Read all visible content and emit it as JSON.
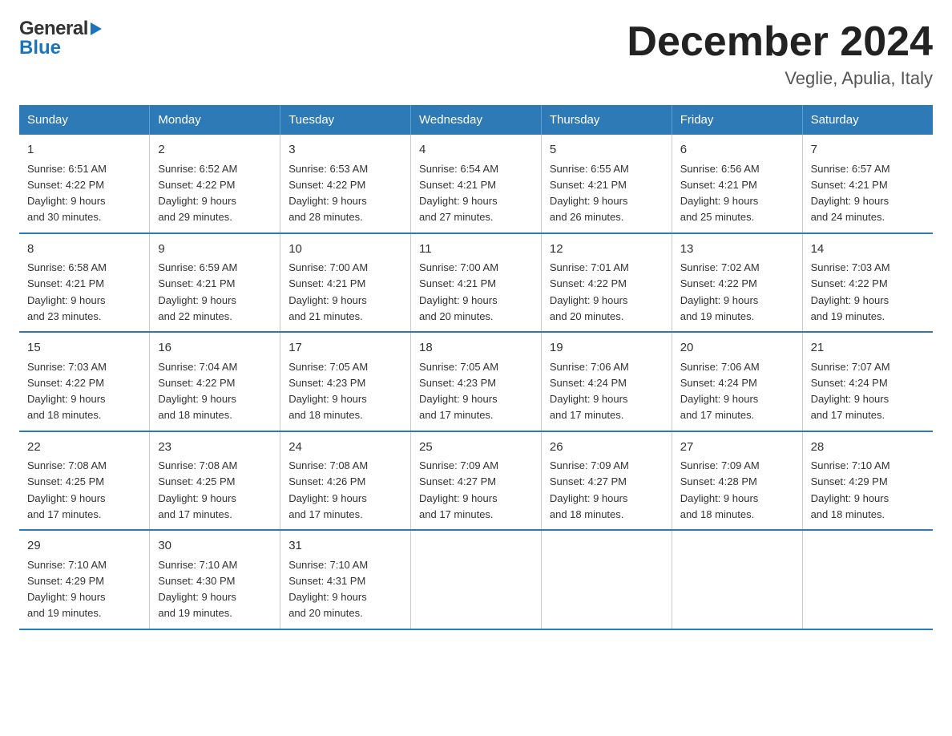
{
  "logo": {
    "line1": "General",
    "line2": "Blue"
  },
  "title": "December 2024",
  "subtitle": "Veglie, Apulia, Italy",
  "days_of_week": [
    "Sunday",
    "Monday",
    "Tuesday",
    "Wednesday",
    "Thursday",
    "Friday",
    "Saturday"
  ],
  "weeks": [
    [
      {
        "day": "1",
        "sunrise": "6:51 AM",
        "sunset": "4:22 PM",
        "daylight": "9 hours and 30 minutes."
      },
      {
        "day": "2",
        "sunrise": "6:52 AM",
        "sunset": "4:22 PM",
        "daylight": "9 hours and 29 minutes."
      },
      {
        "day": "3",
        "sunrise": "6:53 AM",
        "sunset": "4:22 PM",
        "daylight": "9 hours and 28 minutes."
      },
      {
        "day": "4",
        "sunrise": "6:54 AM",
        "sunset": "4:21 PM",
        "daylight": "9 hours and 27 minutes."
      },
      {
        "day": "5",
        "sunrise": "6:55 AM",
        "sunset": "4:21 PM",
        "daylight": "9 hours and 26 minutes."
      },
      {
        "day": "6",
        "sunrise": "6:56 AM",
        "sunset": "4:21 PM",
        "daylight": "9 hours and 25 minutes."
      },
      {
        "day": "7",
        "sunrise": "6:57 AM",
        "sunset": "4:21 PM",
        "daylight": "9 hours and 24 minutes."
      }
    ],
    [
      {
        "day": "8",
        "sunrise": "6:58 AM",
        "sunset": "4:21 PM",
        "daylight": "9 hours and 23 minutes."
      },
      {
        "day": "9",
        "sunrise": "6:59 AM",
        "sunset": "4:21 PM",
        "daylight": "9 hours and 22 minutes."
      },
      {
        "day": "10",
        "sunrise": "7:00 AM",
        "sunset": "4:21 PM",
        "daylight": "9 hours and 21 minutes."
      },
      {
        "day": "11",
        "sunrise": "7:00 AM",
        "sunset": "4:21 PM",
        "daylight": "9 hours and 20 minutes."
      },
      {
        "day": "12",
        "sunrise": "7:01 AM",
        "sunset": "4:22 PM",
        "daylight": "9 hours and 20 minutes."
      },
      {
        "day": "13",
        "sunrise": "7:02 AM",
        "sunset": "4:22 PM",
        "daylight": "9 hours and 19 minutes."
      },
      {
        "day": "14",
        "sunrise": "7:03 AM",
        "sunset": "4:22 PM",
        "daylight": "9 hours and 19 minutes."
      }
    ],
    [
      {
        "day": "15",
        "sunrise": "7:03 AM",
        "sunset": "4:22 PM",
        "daylight": "9 hours and 18 minutes."
      },
      {
        "day": "16",
        "sunrise": "7:04 AM",
        "sunset": "4:22 PM",
        "daylight": "9 hours and 18 minutes."
      },
      {
        "day": "17",
        "sunrise": "7:05 AM",
        "sunset": "4:23 PM",
        "daylight": "9 hours and 18 minutes."
      },
      {
        "day": "18",
        "sunrise": "7:05 AM",
        "sunset": "4:23 PM",
        "daylight": "9 hours and 17 minutes."
      },
      {
        "day": "19",
        "sunrise": "7:06 AM",
        "sunset": "4:24 PM",
        "daylight": "9 hours and 17 minutes."
      },
      {
        "day": "20",
        "sunrise": "7:06 AM",
        "sunset": "4:24 PM",
        "daylight": "9 hours and 17 minutes."
      },
      {
        "day": "21",
        "sunrise": "7:07 AM",
        "sunset": "4:24 PM",
        "daylight": "9 hours and 17 minutes."
      }
    ],
    [
      {
        "day": "22",
        "sunrise": "7:08 AM",
        "sunset": "4:25 PM",
        "daylight": "9 hours and 17 minutes."
      },
      {
        "day": "23",
        "sunrise": "7:08 AM",
        "sunset": "4:25 PM",
        "daylight": "9 hours and 17 minutes."
      },
      {
        "day": "24",
        "sunrise": "7:08 AM",
        "sunset": "4:26 PM",
        "daylight": "9 hours and 17 minutes."
      },
      {
        "day": "25",
        "sunrise": "7:09 AM",
        "sunset": "4:27 PM",
        "daylight": "9 hours and 17 minutes."
      },
      {
        "day": "26",
        "sunrise": "7:09 AM",
        "sunset": "4:27 PM",
        "daylight": "9 hours and 18 minutes."
      },
      {
        "day": "27",
        "sunrise": "7:09 AM",
        "sunset": "4:28 PM",
        "daylight": "9 hours and 18 minutes."
      },
      {
        "day": "28",
        "sunrise": "7:10 AM",
        "sunset": "4:29 PM",
        "daylight": "9 hours and 18 minutes."
      }
    ],
    [
      {
        "day": "29",
        "sunrise": "7:10 AM",
        "sunset": "4:29 PM",
        "daylight": "9 hours and 19 minutes."
      },
      {
        "day": "30",
        "sunrise": "7:10 AM",
        "sunset": "4:30 PM",
        "daylight": "9 hours and 19 minutes."
      },
      {
        "day": "31",
        "sunrise": "7:10 AM",
        "sunset": "4:31 PM",
        "daylight": "9 hours and 20 minutes."
      },
      null,
      null,
      null,
      null
    ]
  ],
  "labels": {
    "sunrise": "Sunrise: ",
    "sunset": "Sunset: ",
    "daylight": "Daylight: "
  }
}
